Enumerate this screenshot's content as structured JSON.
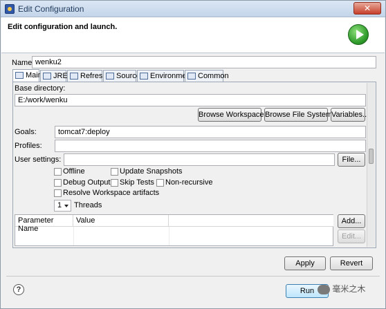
{
  "window": {
    "title": "Edit Configuration"
  },
  "header": {
    "heading": "Edit configuration and launch."
  },
  "name": {
    "label": "Name:",
    "value": "wenku2"
  },
  "tabs": [
    {
      "label": "Main",
      "icon": "main-tab-icon"
    },
    {
      "label": "JRE",
      "icon": "jre-icon"
    },
    {
      "label": "Refresh",
      "icon": "refresh-icon"
    },
    {
      "label": "Source",
      "icon": "source-icon"
    },
    {
      "label": "Environment",
      "icon": "environment-icon"
    },
    {
      "label": "Common",
      "icon": "common-icon"
    }
  ],
  "main": {
    "base_dir_label": "Base directory:",
    "base_dir_value": "E:/work/wenku",
    "browse_workspace": "Browse Workspace...",
    "browse_file_system": "Browse File System...",
    "variables": "Variables...",
    "goals_label": "Goals:",
    "goals_value": "tomcat7:deploy",
    "profiles_label": "Profiles:",
    "profiles_value": "",
    "user_settings_label": "User settings:",
    "user_settings_value": "",
    "file_button": "File...",
    "checkboxes": {
      "offline": "Offline",
      "update_snapshots": "Update Snapshots",
      "debug_output": "Debug Output",
      "skip_tests": "Skip Tests",
      "non_recursive": "Non-recursive",
      "resolve_workspace": "Resolve Workspace artifacts"
    },
    "threads_value": "1",
    "threads_label": "Threads",
    "params_table": {
      "columns": [
        "Parameter Name",
        "Value"
      ]
    },
    "add_button": "Add...",
    "edit_button": "Edit..."
  },
  "footer": {
    "apply": "Apply",
    "revert": "Revert",
    "run": "Run",
    "watermark": "毫米之木"
  }
}
